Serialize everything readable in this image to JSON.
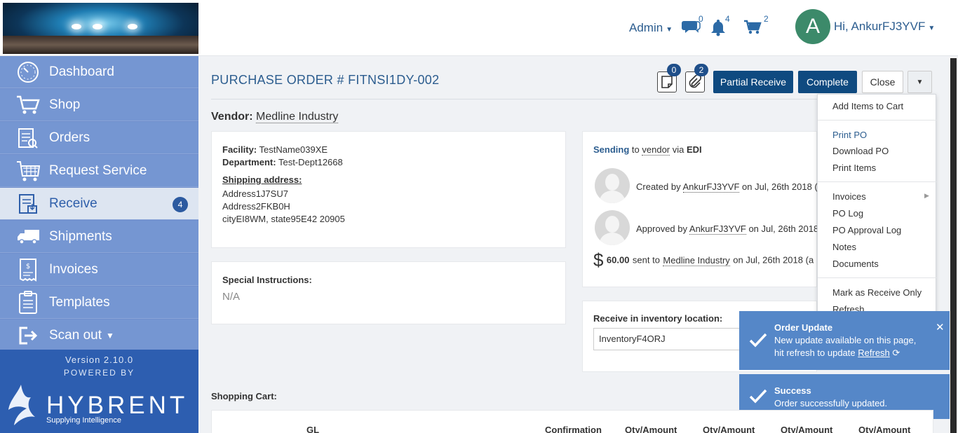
{
  "header": {
    "admin_label": "Admin",
    "messages_count": "0",
    "notifications_count": "4",
    "cart_count": "2",
    "avatar_letter": "A",
    "greeting": "Hi, AnkurFJ3YVF"
  },
  "sidebar": {
    "items": [
      {
        "label": "Dashboard",
        "icon": "dashboard-icon"
      },
      {
        "label": "Shop",
        "icon": "cart-icon"
      },
      {
        "label": "Orders",
        "icon": "orders-icon"
      },
      {
        "label": "Request Service",
        "icon": "service-icon"
      },
      {
        "label": "Receive",
        "icon": "receive-icon",
        "count": "4"
      },
      {
        "label": "Shipments",
        "icon": "truck-icon"
      },
      {
        "label": "Invoices",
        "icon": "invoice-icon"
      },
      {
        "label": "Templates",
        "icon": "templates-icon"
      },
      {
        "label": "Scan out",
        "icon": "scan-out-icon"
      }
    ],
    "version": "Version 2.10.0",
    "powered_by": "POWERED BY",
    "brand": "HYBRENT",
    "tagline": "Supplying Intelligence"
  },
  "po": {
    "title": "PURCHASE ORDER # FITNSI1DY-002",
    "notes_count": "0",
    "attachments_count": "2",
    "btn_partial": "Partial Receive",
    "btn_complete": "Complete",
    "btn_close": "Close",
    "vendor_label": "Vendor:",
    "vendor_name": "Medline Industry"
  },
  "facility": {
    "facility_label": "Facility:",
    "facility_value": "TestName039XE",
    "department_label": "Department:",
    "department_value": "Test-Dept12668",
    "shipping_label": "Shipping address:",
    "address1": "Address1J7SU7",
    "address2": "Address2FKB0H",
    "address3": "cityEI8WM, state95E42 20905"
  },
  "special": {
    "label": "Special Instructions:",
    "value": "N/A"
  },
  "sending": {
    "sending": "Sending",
    "to": "to",
    "vendor": "vendor",
    "via": "via",
    "edi": "EDI",
    "created_prefix": "Created by",
    "created_user": "AnkurFJ3YVF",
    "created_suffix": "on Jul, 26th 2018 (",
    "approved_prefix": "Approved by",
    "approved_user": "AnkurFJ3YVF",
    "approved_suffix": "on Jul, 26th 2018",
    "dollar": "$",
    "amount": "60.00",
    "sent_to": "sent to",
    "sent_vendor": "Medline Industry",
    "sent_suffix": "on Jul, 26th 2018 (a"
  },
  "inventory": {
    "label": "Receive in inventory location:",
    "value": "InventoryF4ORJ"
  },
  "dropdown": {
    "items": [
      "Add Items to Cart",
      "Print PO",
      "Download PO",
      "Print Items",
      "Invoices",
      "PO Log",
      "PO Approval Log",
      "Notes",
      "Documents",
      "Mark as Receive Only",
      "Refresh"
    ]
  },
  "toast_update": {
    "title": "Order Update",
    "line1": "New update available on this page,",
    "line2": "hit refresh to update",
    "refresh": "Refresh"
  },
  "toast_success": {
    "title": "Success",
    "message": "Order successfully updated."
  },
  "cart": {
    "label": "Shopping Cart:",
    "columns": [
      "GL",
      "Confirmation",
      "Qty/Amount",
      "Qty/Amount",
      "Qty/Amount",
      "Qty/Amount"
    ]
  },
  "colors": {
    "sidebar": "#7596d2",
    "primary_button": "#0f4a80",
    "link": "#2c5d8f",
    "toast": "#5587c8"
  }
}
